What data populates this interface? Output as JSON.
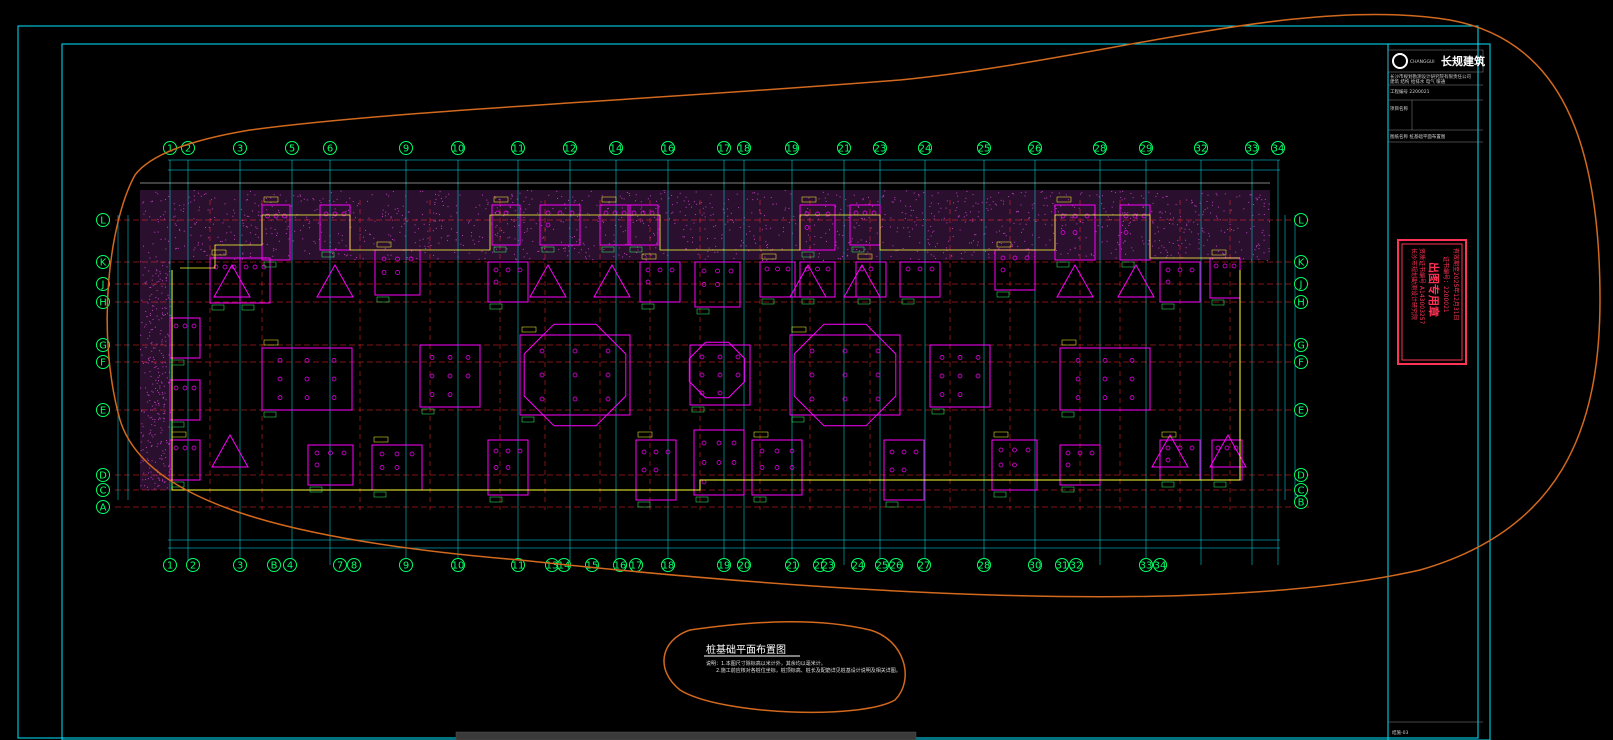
{
  "drawing": {
    "title": "桩基础平面布置图",
    "notes": [
      "说明：1.本图尺寸除标高以米计外，其余均以毫米计。",
      "2.施工前应核对各桩位坐标，桩顶标高、桩长及配筋详见桩基设计说明及相关详图。"
    ]
  },
  "grid_axes": {
    "top": [
      "1",
      "2",
      "3",
      "5",
      "6",
      "9",
      "10",
      "11",
      "12",
      "14",
      "16",
      "17",
      "18",
      "19",
      "21",
      "23",
      "24",
      "25",
      "26",
      "28",
      "29",
      "32",
      "33",
      "34"
    ],
    "bottom": [
      "1",
      "2",
      "3",
      "B",
      "4",
      "7",
      "8",
      "9",
      "10",
      "11",
      "13",
      "14",
      "15",
      "16",
      "17",
      "18",
      "19",
      "20",
      "21",
      "22",
      "23",
      "24",
      "25",
      "26",
      "27",
      "28",
      "30",
      "31",
      "32",
      "33",
      "34"
    ],
    "left": [
      "L",
      "K",
      "J",
      "H",
      "G",
      "F",
      "E",
      "D",
      "C",
      "A"
    ],
    "right": [
      "L",
      "K",
      "J",
      "H",
      "G",
      "F",
      "E",
      "D",
      "C",
      "B"
    ]
  },
  "title_block": {
    "company": "长规建筑",
    "company_en": "CHANGGUI",
    "rows": [
      "长沙市规划勘测设计研究院有限责任公司",
      "建筑 结构 给排水 电气 暖通",
      "工程编号 2200021",
      "项目名称",
      "图纸名称 桩基础平面布置图"
    ],
    "footer": "结施-03"
  },
  "stamp": {
    "title": "出图专用章",
    "lines": [
      "长沙市规划勘测设计研究院",
      "资质证书编号 A143003257",
      "证书编号：2200021",
      "有效期至2025年12月31日"
    ]
  },
  "colors": {
    "background": "#000000",
    "frame": "#00e5ff",
    "axis": "#00ff66",
    "pile_cap": "#ff00ff",
    "grid_line": "#ff2a2a",
    "annotation": "#ffff33",
    "dimension": "#d0d0d0",
    "stamp": "#ff3355",
    "markup": "#d2691e"
  }
}
